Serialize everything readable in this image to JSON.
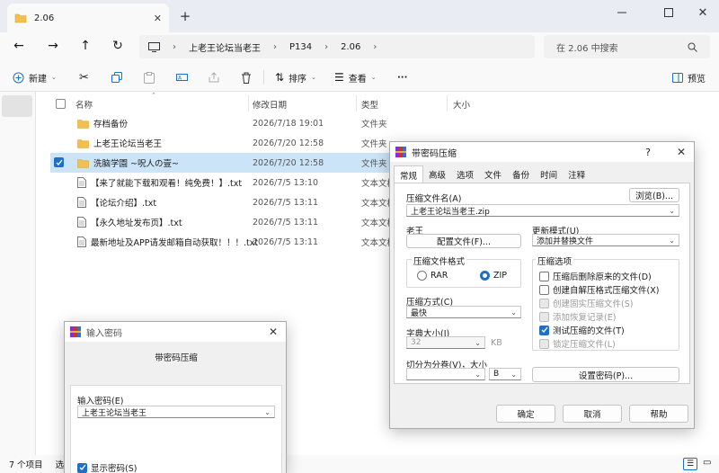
{
  "explorer": {
    "tab_title": "2.06",
    "breadcrumb": [
      "上老王论坛当老王",
      "P134",
      "2.06"
    ],
    "search_placeholder": "在 2.06 中搜索",
    "toolbar": {
      "new_label": "新建",
      "sort_label": "排序",
      "view_label": "查看",
      "more_label": "···",
      "preview_label": "预览"
    },
    "columns": {
      "name": "名称",
      "date": "修改日期",
      "type": "类型",
      "size": "大小"
    },
    "files": [
      {
        "name": "存档备份",
        "date": "2026/7/18 19:01",
        "type": "文件夹",
        "icon": "folder-icon",
        "selected": false
      },
      {
        "name": "上老王论坛当老王",
        "date": "2026/7/20 12:58",
        "type": "文件夹",
        "icon": "folder-icon",
        "selected": false
      },
      {
        "name": "洗脑学園 ~呪人の壹~",
        "date": "2026/7/20 12:58",
        "type": "文件夹",
        "icon": "folder-icon",
        "selected": true
      },
      {
        "name": "【来了就能下载和观看！纯免费！】.txt",
        "date": "2026/7/5 13:10",
        "type": "文本文档",
        "icon": "text-file-icon",
        "selected": false
      },
      {
        "name": "【论坛介绍】.txt",
        "date": "2026/7/5 13:11",
        "type": "文本文档",
        "icon": "text-file-icon",
        "selected": false
      },
      {
        "name": "【永久地址发布页】.txt",
        "date": "2026/7/5 13:11",
        "type": "文本文档",
        "icon": "text-file-icon",
        "selected": false
      },
      {
        "name": "最新地址及APP请发邮箱自动获取！！！.txt",
        "date": "2026/7/5 13:11",
        "type": "文本文档",
        "icon": "text-file-icon",
        "selected": false
      }
    ],
    "status": {
      "count": "7 个项目",
      "selected": "选"
    }
  },
  "archive_dialog": {
    "title": "带密码压缩",
    "tabs": [
      "常规",
      "高级",
      "选项",
      "文件",
      "备份",
      "时间",
      "注释"
    ],
    "archive_name_label": "压缩文件名(A)",
    "browse_label": "浏览(B)...",
    "archive_name_value": "上老王论坛当老王.zip",
    "profile_label": "老王",
    "profile_button": "配置文件(F)...",
    "update_mode_label": "更新模式(U)",
    "update_mode_value": "添加并替换文件",
    "format_group_label": "压缩文件格式",
    "format_rar": "RAR",
    "format_zip": "ZIP",
    "method_label": "压缩方式(C)",
    "method_value": "最快",
    "dict_label": "字典大小(I)",
    "dict_value": "32",
    "dict_unit": "KB",
    "split_label": "切分为分卷(V)，大小",
    "split_unit": "B",
    "options_group_label": "压缩选项",
    "options": [
      {
        "label": "压缩后删除原来的文件(D)",
        "checked": false,
        "disabled": false
      },
      {
        "label": "创建自解压格式压缩文件(X)",
        "checked": false,
        "disabled": false
      },
      {
        "label": "创建固实压缩文件(S)",
        "checked": false,
        "disabled": true
      },
      {
        "label": "添加恢复记录(E)",
        "checked": false,
        "disabled": true
      },
      {
        "label": "测试压缩的文件(T)",
        "checked": true,
        "disabled": false
      },
      {
        "label": "锁定压缩文件(L)",
        "checked": false,
        "disabled": true
      }
    ],
    "set_password_label": "设置密码(P)...",
    "ok_label": "确定",
    "cancel_label": "取消",
    "help_label": "帮助"
  },
  "password_dialog": {
    "title": "输入密码",
    "heading": "带密码压缩",
    "input_label": "输入密码(E)",
    "input_value": "上老王论坛当老王",
    "show_password_label": "显示密码(S)"
  },
  "colors": {
    "accent": "#1f6fc5",
    "folder": "#f0c050",
    "selection": "#cce4f7"
  }
}
